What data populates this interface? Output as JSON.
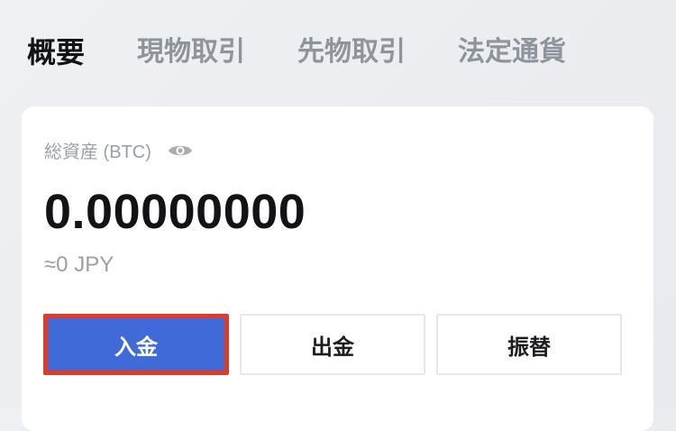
{
  "tabs": [
    {
      "label": "概要",
      "active": true
    },
    {
      "label": "現物取引",
      "active": false
    },
    {
      "label": "先物取引",
      "active": false
    },
    {
      "label": "法定通貨",
      "active": false
    }
  ],
  "asset_card": {
    "label": "総資産 (BTC)",
    "visibility_icon": "eye-icon",
    "balance": "0.00000000",
    "fiat_value": "≈0 JPY"
  },
  "actions": {
    "deposit_label": "入金",
    "withdraw_label": "出金",
    "transfer_label": "振替"
  },
  "colors": {
    "primary": "#3f6ad8",
    "highlight_border": "#e23b25",
    "text_dark": "#111316",
    "text_muted": "#9a9ea6",
    "tab_inactive": "#8e949b"
  }
}
